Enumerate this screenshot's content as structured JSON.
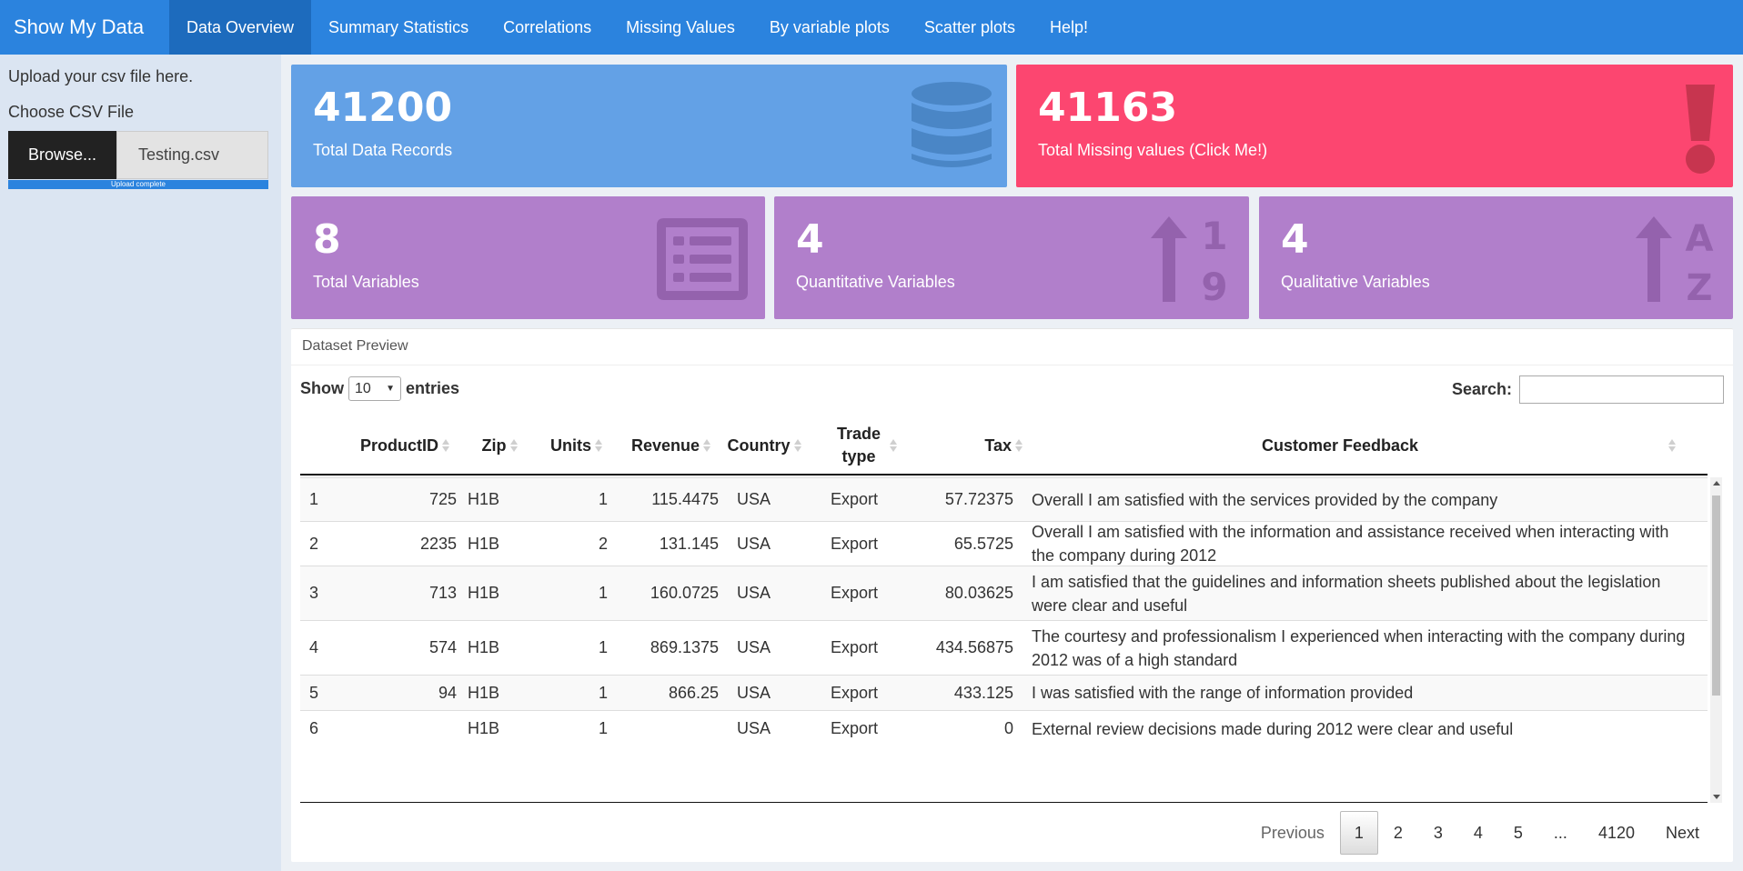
{
  "nav": {
    "brand": "Show My Data",
    "tabs": [
      {
        "label": "Data Overview",
        "active": true
      },
      {
        "label": "Summary Statistics"
      },
      {
        "label": "Correlations"
      },
      {
        "label": "Missing Values"
      },
      {
        "label": "By variable plots"
      },
      {
        "label": "Scatter plots"
      },
      {
        "label": "Help!"
      }
    ]
  },
  "sidebar": {
    "upload_label": "Upload your csv file here.",
    "choose_label": "Choose CSV File",
    "browse_label": "Browse...",
    "file_name": "Testing.csv",
    "progress_text": "Upload complete",
    "progress": 1.0
  },
  "boxes": {
    "records": {
      "value": "41200",
      "label": "Total Data Records",
      "icon": "database-icon"
    },
    "missing": {
      "value": "41163",
      "label": "Total Missing values (Click Me!)",
      "icon": "exclamation-icon"
    },
    "variables": {
      "value": "8",
      "label": "Total Variables",
      "icon": "list-icon"
    },
    "quantitative": {
      "value": "4",
      "label": "Quantitative Variables",
      "icon": "sort-numeric-icon",
      "glyph_top": "1",
      "glyph_bottom": "9"
    },
    "qualitative": {
      "value": "4",
      "label": "Qualitative Variables",
      "icon": "sort-alpha-icon",
      "glyph_top": "A",
      "glyph_bottom": "Z"
    }
  },
  "colors": {
    "nav": "#2b83de",
    "blue_box": "#63a1e6",
    "red_box": "#fc4670",
    "purple_box": "#b17fcb"
  },
  "preview": {
    "title": "Dataset Preview",
    "show_label": "Show",
    "entries_value": "10",
    "entries_label": "entries",
    "search_label": "Search:",
    "search_value": "",
    "columns": [
      "",
      "ProductID",
      "Zip",
      "Units",
      "Revenue",
      "Country",
      "Trade type",
      "Tax",
      "Customer Feedback"
    ],
    "rows": [
      [
        "1",
        "725",
        "H1B",
        "1",
        "115.4475",
        "USA",
        "Export",
        "57.72375",
        "Overall I am satisfied with the services provided by the company"
      ],
      [
        "2",
        "2235",
        "H1B",
        "2",
        "131.145",
        "USA",
        "Export",
        "65.5725",
        "Overall I am satisfied with the information and assistance received when interacting with the company during 2012"
      ],
      [
        "3",
        "713",
        "H1B",
        "1",
        "160.0725",
        "USA",
        "Export",
        "80.03625",
        "I am satisfied that the guidelines and information sheets published about the legislation were clear and useful"
      ],
      [
        "4",
        "574",
        "H1B",
        "1",
        "869.1375",
        "USA",
        "Export",
        "434.56875",
        "The courtesy and professionalism I experienced when interacting with the company during 2012 was of a high standard"
      ],
      [
        "5",
        "94",
        "H1B",
        "1",
        "866.25",
        "USA",
        "Export",
        "433.125",
        "I was satisfied with the range of information provided"
      ],
      [
        "6",
        "",
        "H1B",
        "1",
        "",
        "USA",
        "Export",
        "0",
        "External review decisions made during 2012 were clear and useful"
      ]
    ],
    "pagination": {
      "previous": "Previous",
      "pages": [
        "1",
        "2",
        "3",
        "4",
        "5",
        "...",
        "4120"
      ],
      "current": "1",
      "next": "Next"
    }
  }
}
